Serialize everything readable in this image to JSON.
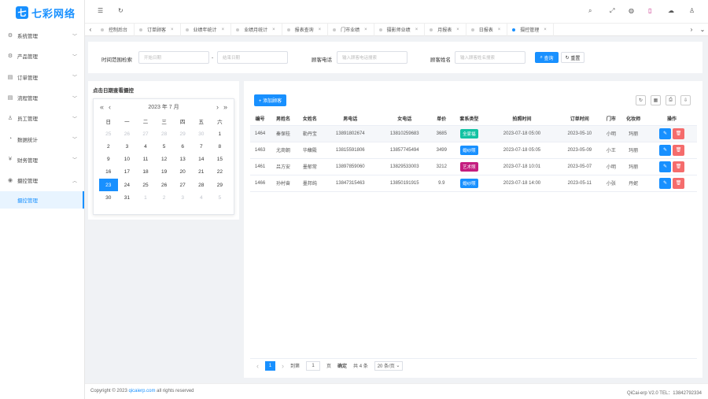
{
  "app": {
    "logo_mark": "七",
    "logo_text": "七彩网络"
  },
  "sidebar": {
    "items": [
      {
        "label": "系统管理",
        "icon": "gear-icon",
        "glyph": "⚙"
      },
      {
        "label": "产品管理",
        "icon": "gear-icon",
        "glyph": "⚙"
      },
      {
        "label": "订单管理",
        "icon": "document-icon",
        "glyph": "▤"
      },
      {
        "label": "流程管理",
        "icon": "document-icon",
        "glyph": "▤"
      },
      {
        "label": "员工管理",
        "icon": "user-icon",
        "glyph": "♙"
      },
      {
        "label": "数据统计",
        "icon": "chart-icon",
        "glyph": "◔"
      },
      {
        "label": "财务管理",
        "icon": "money-icon",
        "glyph": "¥"
      },
      {
        "label": "摄控管理",
        "icon": "camera-icon",
        "glyph": "◉"
      }
    ],
    "sub_item": "摄控管理"
  },
  "tabs": [
    {
      "label": "控制后台",
      "closable": false,
      "active": false
    },
    {
      "label": "订单顾客",
      "closable": true,
      "active": false
    },
    {
      "label": "业绩年统计",
      "closable": true,
      "active": false
    },
    {
      "label": "业绩月统计",
      "closable": true,
      "active": false
    },
    {
      "label": "报表查询",
      "closable": true,
      "active": false
    },
    {
      "label": "门市业绩",
      "closable": true,
      "active": false
    },
    {
      "label": "摄影师业绩",
      "closable": true,
      "active": false
    },
    {
      "label": "月报表",
      "closable": true,
      "active": false
    },
    {
      "label": "日报表",
      "closable": true,
      "active": false
    },
    {
      "label": "摄控管理",
      "closable": true,
      "active": true
    }
  ],
  "search": {
    "time_label": "时间范围检索",
    "start_placeholder": "开始日期",
    "range_sep": "-",
    "end_placeholder": "结束日期",
    "phone_label": "顾客电话",
    "phone_placeholder": "输入顾客电话搜索",
    "name_label": "顾客姓名",
    "name_placeholder": "输入顾客姓名搜索",
    "search_btn": "查询",
    "reset_btn": "重置"
  },
  "calendar": {
    "title": "点击日期查看摄控",
    "year_month": "2023 年  7 月",
    "weekdays": [
      "日",
      "一",
      "二",
      "三",
      "四",
      "五",
      "六"
    ],
    "days": [
      {
        "d": "25",
        "m": true
      },
      {
        "d": "26",
        "m": true
      },
      {
        "d": "27",
        "m": true
      },
      {
        "d": "28",
        "m": true
      },
      {
        "d": "29",
        "m": true
      },
      {
        "d": "30",
        "m": true
      },
      {
        "d": "1",
        "m": false
      },
      {
        "d": "2",
        "m": false
      },
      {
        "d": "3",
        "m": false
      },
      {
        "d": "4",
        "m": false
      },
      {
        "d": "5",
        "m": false
      },
      {
        "d": "6",
        "m": false
      },
      {
        "d": "7",
        "m": false
      },
      {
        "d": "8",
        "m": false
      },
      {
        "d": "9",
        "m": false
      },
      {
        "d": "10",
        "m": false
      },
      {
        "d": "11",
        "m": false
      },
      {
        "d": "12",
        "m": false
      },
      {
        "d": "13",
        "m": false
      },
      {
        "d": "14",
        "m": false
      },
      {
        "d": "15",
        "m": false
      },
      {
        "d": "16",
        "m": false
      },
      {
        "d": "17",
        "m": false
      },
      {
        "d": "18",
        "m": false
      },
      {
        "d": "19",
        "m": false
      },
      {
        "d": "20",
        "m": false
      },
      {
        "d": "21",
        "m": false
      },
      {
        "d": "22",
        "m": false
      },
      {
        "d": "23",
        "m": false,
        "today": true
      },
      {
        "d": "24",
        "m": false
      },
      {
        "d": "25",
        "m": false
      },
      {
        "d": "26",
        "m": false
      },
      {
        "d": "27",
        "m": false
      },
      {
        "d": "28",
        "m": false
      },
      {
        "d": "29",
        "m": false
      },
      {
        "d": "30",
        "m": false
      },
      {
        "d": "31",
        "m": false
      },
      {
        "d": "1",
        "m": true
      },
      {
        "d": "2",
        "m": true
      },
      {
        "d": "3",
        "m": true
      },
      {
        "d": "4",
        "m": true
      },
      {
        "d": "5",
        "m": true
      }
    ]
  },
  "table": {
    "add_btn": "+ 添加顾客",
    "columns": [
      "编号",
      "男姓名",
      "女姓名",
      "男电话",
      "女电话",
      "单价",
      "套系类型",
      "拍照时间",
      "订单时间",
      "门市",
      "化妆师",
      "操作"
    ],
    "rows": [
      {
        "id": "1464",
        "male": "秦保桂",
        "female": "勒丹宝",
        "mphone": "13891802674",
        "fphone": "13810259683",
        "price": "3685",
        "pkg": "全家福",
        "pkg_color": "#13c2a3",
        "shoot": "2023-07-18 05:00",
        "order": "2023-05-10",
        "store": "小明",
        "makeup": "玛丽"
      },
      {
        "id": "1463",
        "male": "尤商朝",
        "female": "华馥殿",
        "mphone": "13815591806",
        "fphone": "13857745494",
        "price": "3499",
        "pkg": "婚纱照",
        "pkg_color": "#1890ff",
        "shoot": "2023-07-18 05:05",
        "order": "2023-05-09",
        "store": "小王",
        "makeup": "玛丽"
      },
      {
        "id": "1461",
        "male": "吕方安",
        "female": "墨郁常",
        "mphone": "13897859060",
        "fphone": "13829533003",
        "price": "3212",
        "pkg": "艺术照",
        "pkg_color": "#c41d7f",
        "shoot": "2023-07-18 10:01",
        "order": "2023-05-07",
        "store": "小明",
        "makeup": "玛丽"
      },
      {
        "id": "1466",
        "male": "孙村奋",
        "female": "墨邦纯",
        "mphone": "13847315463",
        "fphone": "13850191915",
        "price": "9.9",
        "pkg": "婚纱照",
        "pkg_color": "#1890ff",
        "shoot": "2023-07-18 14:00",
        "order": "2023-05-11",
        "store": "小张",
        "makeup": "丹妮"
      }
    ],
    "edit_glyph": "✎",
    "delete_glyph": "🗑"
  },
  "pager": {
    "prev": "‹",
    "current": "1",
    "next": "›",
    "goto_label": "到第",
    "goto_value": "1",
    "page_unit": "页",
    "confirm": "确定",
    "total": "共 4 条",
    "size": "20 条/页"
  },
  "footer": {
    "copyright_prefix": "Copyright © 2023 ",
    "link": "qicaierp.com",
    "copyright_suffix": " all rights reserved",
    "right": "QiCai-erp V2.0 TEL：13842792334"
  },
  "colors": {
    "accent": "#1890ff",
    "danger": "#f56c6c"
  }
}
